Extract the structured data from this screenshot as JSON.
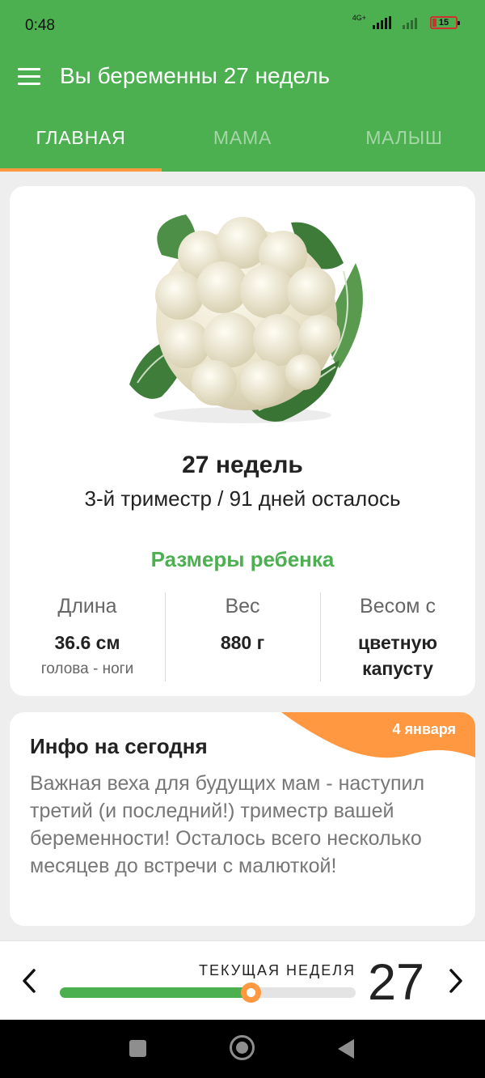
{
  "status_bar": {
    "time": "0:48",
    "network": "4G+",
    "battery": "15",
    "battery_color": "#d32f2f",
    "icons": [
      "signal-icon",
      "wifi-icon",
      "signal-no-sim-icon",
      "battery-icon"
    ]
  },
  "app_bar": {
    "title": "Вы беременны 27 недель",
    "menu_icon": "hamburger-menu-icon",
    "color": "#4caf50"
  },
  "tabs": [
    {
      "label": "ГЛАВНАЯ",
      "active": true
    },
    {
      "label": "МАМА",
      "active": false
    },
    {
      "label": "МАЛЫШ",
      "active": false
    }
  ],
  "accent_color": "#ff9840",
  "main_card": {
    "image": "cauliflower-image",
    "week_title": "27 недель",
    "subtitle": "3-й триместр / 91 дней осталось",
    "sizes_heading": "Размеры ребенка",
    "stats": [
      {
        "label": "Длина",
        "value": "36.6 см",
        "note": "голова - ноги"
      },
      {
        "label": "Вес",
        "value": "880 г",
        "note": ""
      },
      {
        "label": "Весом с",
        "value": "цветную капусту",
        "note": ""
      }
    ]
  },
  "info_card": {
    "date": "4 января",
    "title": "Инфо на сегодня",
    "body": "Важная веха для будущих мам - наступил третий (и последний!) триместр вашей беременности! Осталось всего несколько месяцев до встречи с малюткой!"
  },
  "week_selector": {
    "label": "ТЕКУЩАЯ НЕДЕЛЯ",
    "week": "27",
    "progress_fraction": 0.646,
    "prev_icon": "chevron-left-icon",
    "next_icon": "chevron-right-icon"
  },
  "system_nav": {
    "icons": [
      "recents-square-icon",
      "home-circle-icon",
      "back-triangle-icon"
    ]
  }
}
